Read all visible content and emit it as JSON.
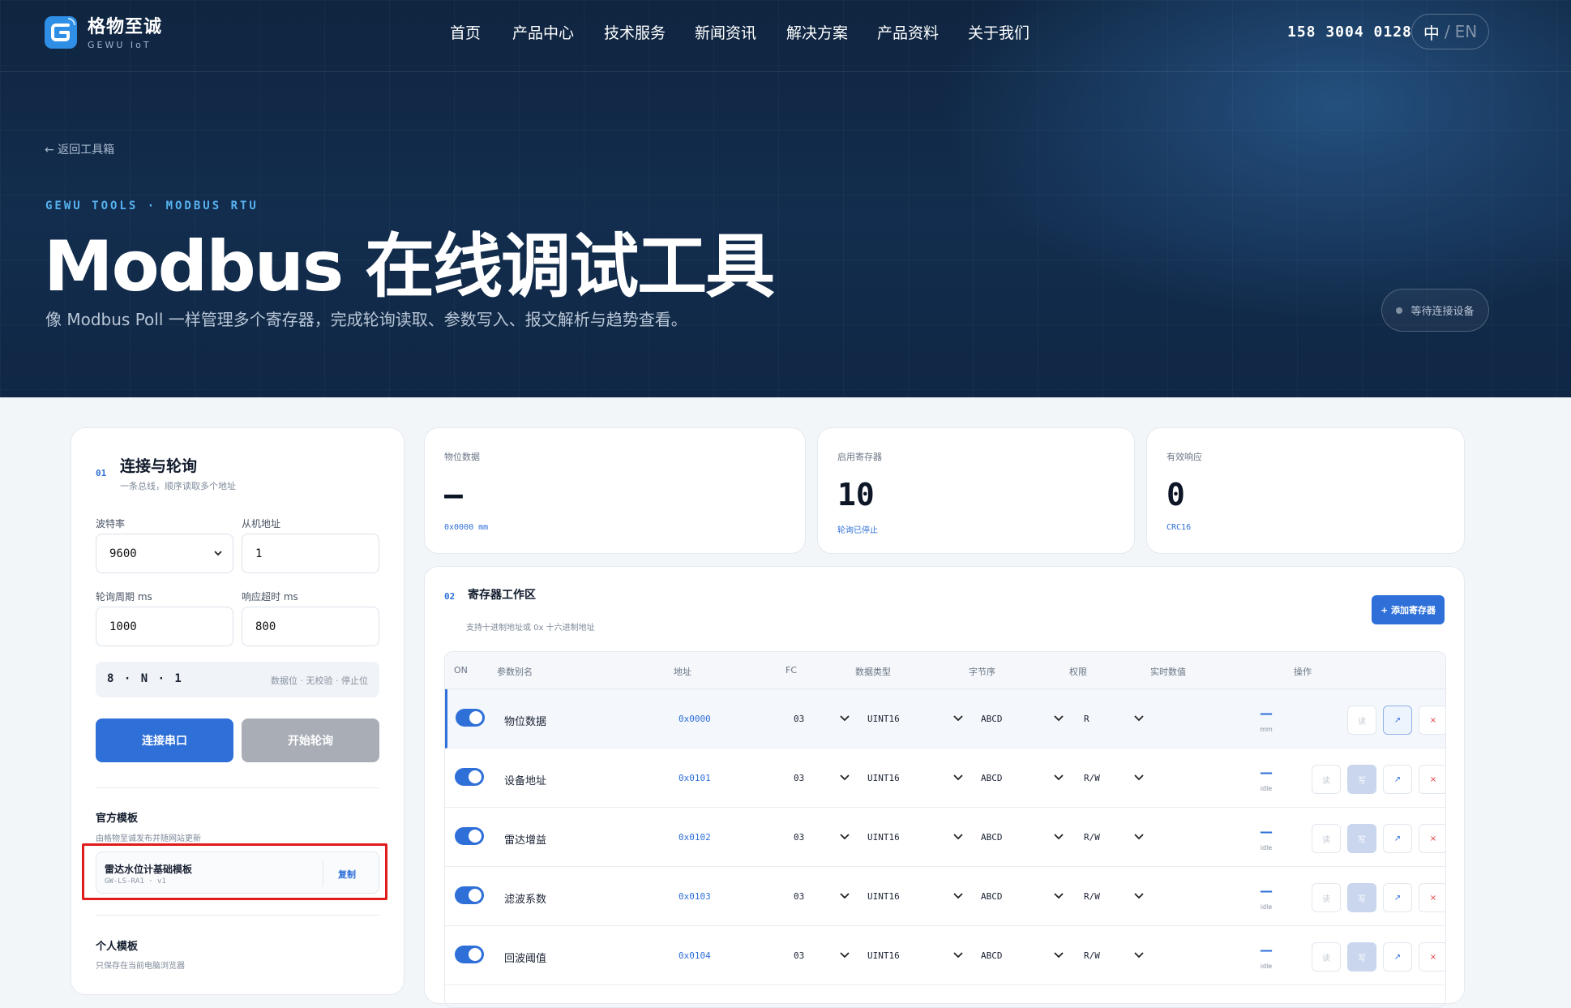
{
  "brand": {
    "name": "格物至诚",
    "sub": "GEWU IoT"
  },
  "nav": [
    "首页",
    "产品中心",
    "技术服务",
    "新闻资讯",
    "解决方案",
    "产品资料",
    "关于我们"
  ],
  "phone": "158 3004 0128",
  "lang": {
    "zh": "中",
    "sep": "/",
    "en": "EN"
  },
  "hero": {
    "back": "← 返回工具箱",
    "eyebrow": "GEWU TOOLS · MODBUS RTU",
    "title": "Modbus 在线调试工具",
    "desc": "像 Modbus Poll 一样管理多个寄存器，完成轮询读取、参数写入、报文解析与趋势查看。",
    "status": "等待连接设备"
  },
  "connection": {
    "no": "01",
    "title": "连接与轮询",
    "sub": "一条总线，顺序读取多个地址",
    "baud_label": "波特率",
    "baud_value": "9600",
    "slave_label": "从机地址",
    "slave_value": "1",
    "period_label": "轮询周期 ms",
    "period_value": "1000",
    "timeout_label": "响应超时 ms",
    "timeout_value": "800",
    "frame_format": "8 · N · 1",
    "frame_desc": "数据位 · 无校验 · 停止位",
    "connect_btn": "连接串口",
    "poll_btn": "开始轮询",
    "official_title": "官方模板",
    "official_sub": "由格物至诚发布并随网站更新",
    "template_name": "雷达水位计基础模板",
    "template_code": "GW-LS-RA1 · v1",
    "template_copy": "复制",
    "personal_title": "个人模板",
    "personal_sub": "只保存在当前电脑浏览器"
  },
  "stats": [
    {
      "label": "物位数据",
      "value": "—",
      "sub": "0x0000 mm"
    },
    {
      "label": "启用寄存器",
      "value": "10",
      "sub": "轮询已停止"
    },
    {
      "label": "有效响应",
      "value": "0",
      "sub": "CRC16"
    }
  ],
  "workspace": {
    "no": "02",
    "title": "寄存器工作区",
    "sub": "支持十进制地址或 0x 十六进制地址",
    "add_btn": "+ 添加寄存器",
    "columns": [
      "ON",
      "参数别名",
      "地址",
      "FC",
      "数据类型",
      "字节序",
      "权限",
      "实时数值",
      "操作"
    ],
    "rows": [
      {
        "name": "物位数据",
        "addr": "0x0000",
        "fc": "03",
        "type": "UINT16",
        "order": "ABCD",
        "perm": "R",
        "value": "—",
        "unit": "mm"
      },
      {
        "name": "设备地址",
        "addr": "0x0101",
        "fc": "03",
        "type": "UINT16",
        "order": "ABCD",
        "perm": "R/W",
        "value": "—",
        "unit": "idle"
      },
      {
        "name": "雷达增益",
        "addr": "0x0102",
        "fc": "03",
        "type": "UINT16",
        "order": "ABCD",
        "perm": "R/W",
        "value": "—",
        "unit": "idle"
      },
      {
        "name": "滤波系数",
        "addr": "0x0103",
        "fc": "03",
        "type": "UINT16",
        "order": "ABCD",
        "perm": "R/W",
        "value": "—",
        "unit": "idle"
      },
      {
        "name": "回波阈值",
        "addr": "0x0104",
        "fc": "03",
        "type": "UINT16",
        "order": "ABCD",
        "perm": "R/W",
        "value": "—",
        "unit": "idle"
      }
    ],
    "ops": {
      "read": "读",
      "write": "写",
      "chart": "↗",
      "del": "×"
    }
  },
  "colors": {
    "accent": "#2e6fd8",
    "hero_bg": "#132d4e",
    "highlight": "#e01b1b"
  }
}
